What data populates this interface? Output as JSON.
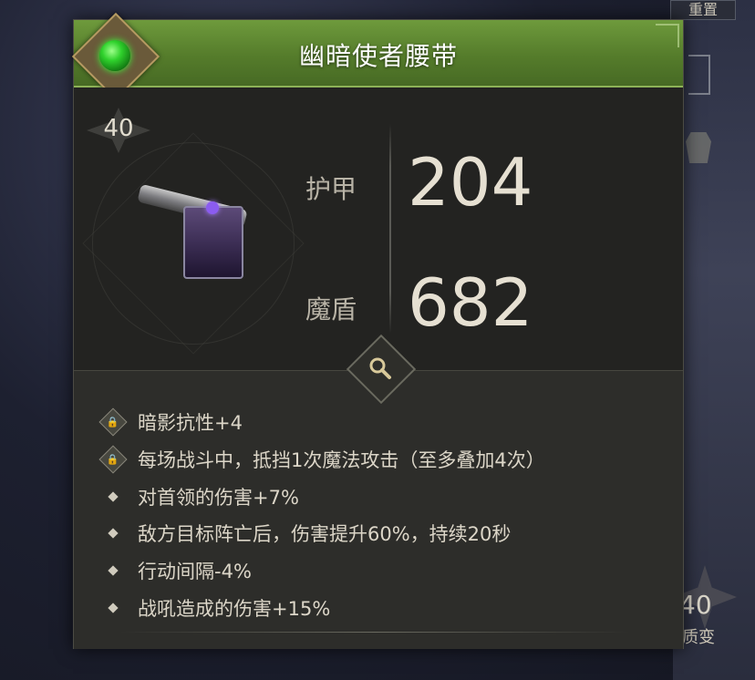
{
  "background": {
    "top_button": "重置",
    "level_badge": "40",
    "level_label": "质变"
  },
  "item": {
    "name": "幽暗使者腰带",
    "level": "40",
    "rarity_color": "#5e8a33",
    "gem_color": "#2fd12c",
    "icon": "belt-icon"
  },
  "stats": [
    {
      "label": "护甲",
      "value": "204"
    },
    {
      "label": "魔盾",
      "value": "682"
    }
  ],
  "inspect_icon": "magnifier-icon",
  "affixes": [
    {
      "text": "暗影抗性+4",
      "icon": "lock-icon"
    },
    {
      "text": "每场战斗中，抵挡1次魔法攻击（至多叠加4次）",
      "icon": "lock-icon"
    },
    {
      "text": "对首领的伤害+7%",
      "icon": "bullet-icon"
    },
    {
      "text": "敌方目标阵亡后，伤害提升60%，持续20秒",
      "icon": "bullet-icon"
    },
    {
      "text": "行动间隔-4%",
      "icon": "bullet-icon"
    },
    {
      "text": "战吼造成的伤害+15%",
      "icon": "bullet-icon"
    }
  ]
}
